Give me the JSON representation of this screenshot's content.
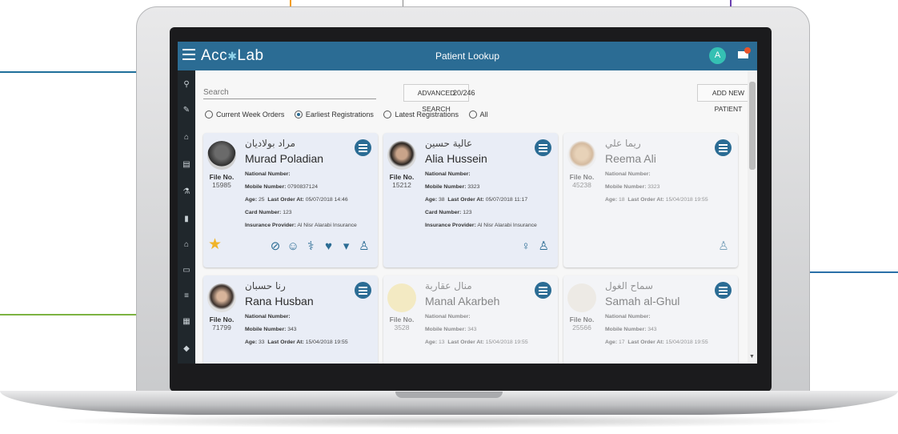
{
  "app": {
    "logo": "Acc",
    "logo_suffix": "Lab",
    "page_title": "Patient Lookup",
    "user_initial": "A"
  },
  "toolbar": {
    "search_placeholder": "Search",
    "advanced_search": "ADVANCED SEARCH",
    "count": "20/246",
    "add_new_patient": "ADD NEW PATIENT"
  },
  "filters": [
    {
      "label": "Current Week Orders",
      "selected": false
    },
    {
      "label": "Earliest Registrations",
      "selected": true
    },
    {
      "label": "Latest Registrations",
      "selected": false
    },
    {
      "label": "All",
      "selected": false
    }
  ],
  "labels": {
    "file_no": "File No.",
    "national_number": "National Number:",
    "mobile_number": "Mobile Number:",
    "age": "Age:",
    "last_order_at": "Last Order At:",
    "card_number": "Card Number:",
    "insurance_provider": "Insurance Provider:"
  },
  "patients": [
    {
      "arabic": "مراد بولاديان",
      "name": "Murad Poladian",
      "file_no": "15985",
      "mobile": "0790837124",
      "age": "25",
      "last_order": "05/07/2018 14:46",
      "card": "123",
      "insurance": "Al Nisr Alarabi Insurance"
    },
    {
      "arabic": "عالية حسين",
      "name": "Alia Hussein",
      "file_no": "15212",
      "mobile": "3323",
      "age": "38",
      "last_order": "05/07/2018 11:17",
      "card": "123",
      "insurance": "Al Nisr Alarabi Insurance"
    },
    {
      "arabic": "ريما علي",
      "name": "Reema Ali",
      "file_no": "45238",
      "mobile": "3323",
      "age": "18",
      "last_order": "15/04/2018 19:55"
    },
    {
      "arabic": "رنا حسبان",
      "name": "Rana Husban",
      "file_no": "71799",
      "mobile": "343",
      "age": "33",
      "last_order": "15/04/2018 19:55"
    },
    {
      "arabic": "منال عقاربة",
      "name": "Manal Akarbeh",
      "file_no": "3528",
      "mobile": "343",
      "age": "13",
      "last_order": "15/04/2018 19:55"
    },
    {
      "arabic": "سماح الغول",
      "name": "Samah al-Ghul",
      "file_no": "25566",
      "mobile": "343",
      "age": "17",
      "last_order": "15/04/2018 19:55"
    }
  ],
  "colors": {
    "topbar": "#2b6c94",
    "sidebar": "#20272c",
    "accent": "#2b6c94",
    "avatar": "#35c0b3",
    "star": "#f0b429"
  },
  "icons": {
    "sidebar": [
      "search-icon",
      "edit-icon",
      "home-icon",
      "clipboard-icon",
      "flask-icon",
      "trash-icon",
      "bank-icon",
      "card-icon",
      "list-icon",
      "printer-icon",
      "shield-icon"
    ]
  }
}
